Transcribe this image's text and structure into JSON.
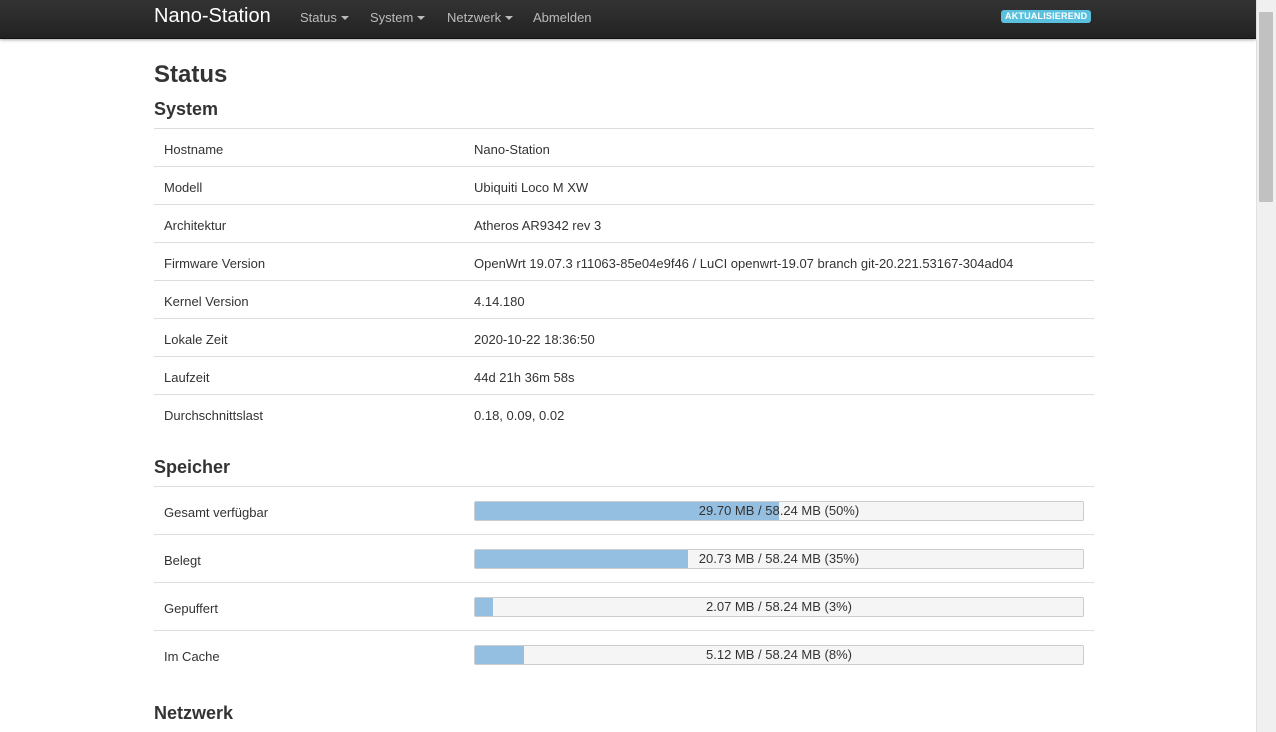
{
  "navbar": {
    "brand": "Nano-Station",
    "menu": [
      {
        "label": "Status",
        "dropdown": true
      },
      {
        "label": "System",
        "dropdown": true
      },
      {
        "label": "Netzwerk",
        "dropdown": true
      },
      {
        "label": "Abmelden",
        "dropdown": false
      }
    ],
    "badge": "AKTUALISIEREND"
  },
  "page_title": "Status",
  "system": {
    "title": "System",
    "rows": [
      {
        "label": "Hostname",
        "value": "Nano-Station"
      },
      {
        "label": "Modell",
        "value": "Ubiquiti Loco M XW"
      },
      {
        "label": "Architektur",
        "value": "Atheros AR9342 rev 3"
      },
      {
        "label": "Firmware Version",
        "value": "OpenWrt 19.07.3 r11063-85e04e9f46 / LuCI openwrt-19.07 branch git-20.221.53167-304ad04"
      },
      {
        "label": "Kernel Version",
        "value": "4.14.180"
      },
      {
        "label": "Lokale Zeit",
        "value": "2020-10-22 18:36:50"
      },
      {
        "label": "Laufzeit",
        "value": "44d 21h 36m 58s"
      },
      {
        "label": "Durchschnittslast",
        "value": "0.18, 0.09, 0.02"
      }
    ]
  },
  "memory": {
    "title": "Speicher",
    "rows": [
      {
        "label": "Gesamt verfügbar",
        "text": "29.70 MB / 58.24 MB (50%)",
        "percent": 50
      },
      {
        "label": "Belegt",
        "text": "20.73 MB / 58.24 MB (35%)",
        "percent": 35
      },
      {
        "label": "Gepuffert",
        "text": "2.07 MB / 58.24 MB (3%)",
        "percent": 3
      },
      {
        "label": "Im Cache",
        "text": "5.12 MB / 58.24 MB (8%)",
        "percent": 8
      }
    ]
  },
  "network": {
    "title": "Netzwerk"
  },
  "colors": {
    "navbar": "#222222",
    "badge": "#5bc0de",
    "bar_fill": "#95bfe0"
  }
}
